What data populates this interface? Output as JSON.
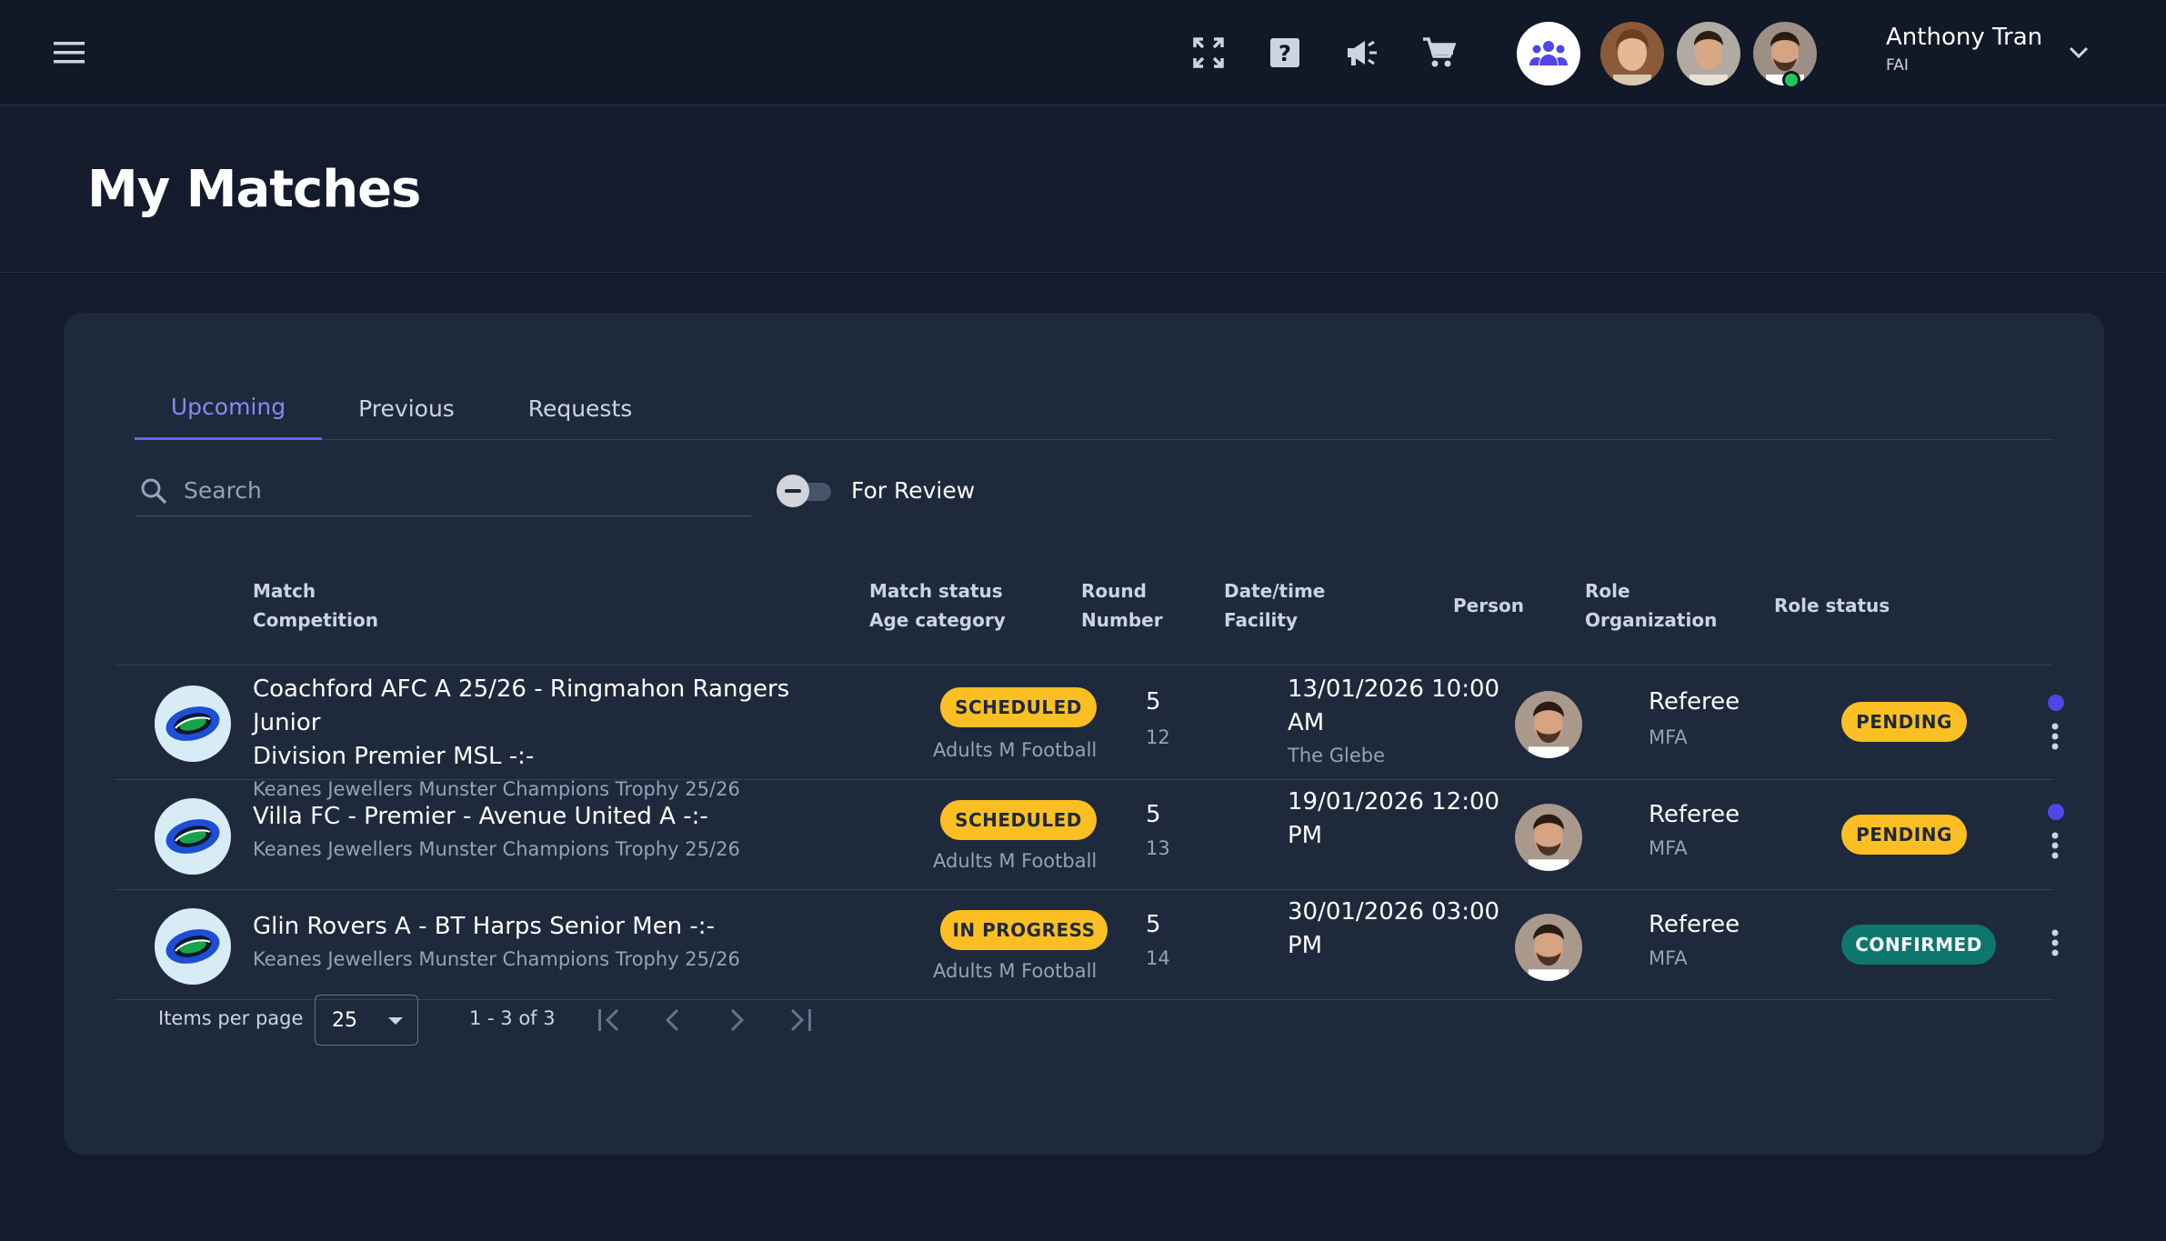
{
  "header": {
    "user_name": "Anthony Tran",
    "user_org": "FAI"
  },
  "page": {
    "title": "My Matches"
  },
  "tabs": [
    {
      "label": "Upcoming",
      "active": true
    },
    {
      "label": "Previous",
      "active": false
    },
    {
      "label": "Requests",
      "active": false
    }
  ],
  "filters": {
    "search_placeholder": "Search",
    "search_value": "",
    "for_review_label": "For Review",
    "for_review_on": false
  },
  "table": {
    "headers": {
      "match": "Match",
      "competition": "Competition",
      "match_status": "Match status",
      "age_category": "Age category",
      "round": "Round",
      "number": "Number",
      "datetime": "Date/time",
      "facility": "Facility",
      "person": "Person",
      "role": "Role",
      "organization": "Organization",
      "role_status": "Role status"
    },
    "rows": [
      {
        "match_line1": "Coachford AFC A 25/26 - Ringmahon Rangers Junior",
        "match_line2": "Division Premier MSL -:-",
        "competition": "Keanes Jewellers Munster Champions Trophy 25/26",
        "match_status": "SCHEDULED",
        "age_category": "Adults M Football",
        "round": "5",
        "number": "12",
        "date_line1": "13/01/2026 10:00",
        "date_line2": "AM",
        "facility": "The Glebe",
        "role": "Referee",
        "organization": "MFA",
        "role_status": "PENDING",
        "unread": true
      },
      {
        "match_line1": "Villa FC - Premier - Avenue United A -:-",
        "competition": "Keanes Jewellers Munster Champions Trophy 25/26",
        "match_status": "SCHEDULED",
        "age_category": "Adults M Football",
        "round": "5",
        "number": "13",
        "date_line1": "19/01/2026 12:00",
        "date_line2": "PM",
        "role": "Referee",
        "organization": "MFA",
        "role_status": "PENDING",
        "unread": true
      },
      {
        "match_line1": "Glin Rovers A - BT Harps Senior Men -:-",
        "competition": "Keanes Jewellers Munster Champions Trophy 25/26",
        "match_status": "IN PROGRESS",
        "age_category": "Adults M Football",
        "round": "5",
        "number": "14",
        "date_line1": "30/01/2026 03:00",
        "date_line2": "PM",
        "role": "Referee",
        "organization": "MFA",
        "role_status": "CONFIRMED",
        "unread": false
      }
    ]
  },
  "pagination": {
    "items_per_page_label": "Items per page",
    "items_per_page_value": "25",
    "range": "1 - 3 of 3"
  },
  "colors": {
    "background": "#141b2d",
    "card": "#1e293b",
    "accent": "#6366f1",
    "pending": "#fbbf24",
    "confirmed": "#0f766e",
    "online": "#22c55e"
  }
}
